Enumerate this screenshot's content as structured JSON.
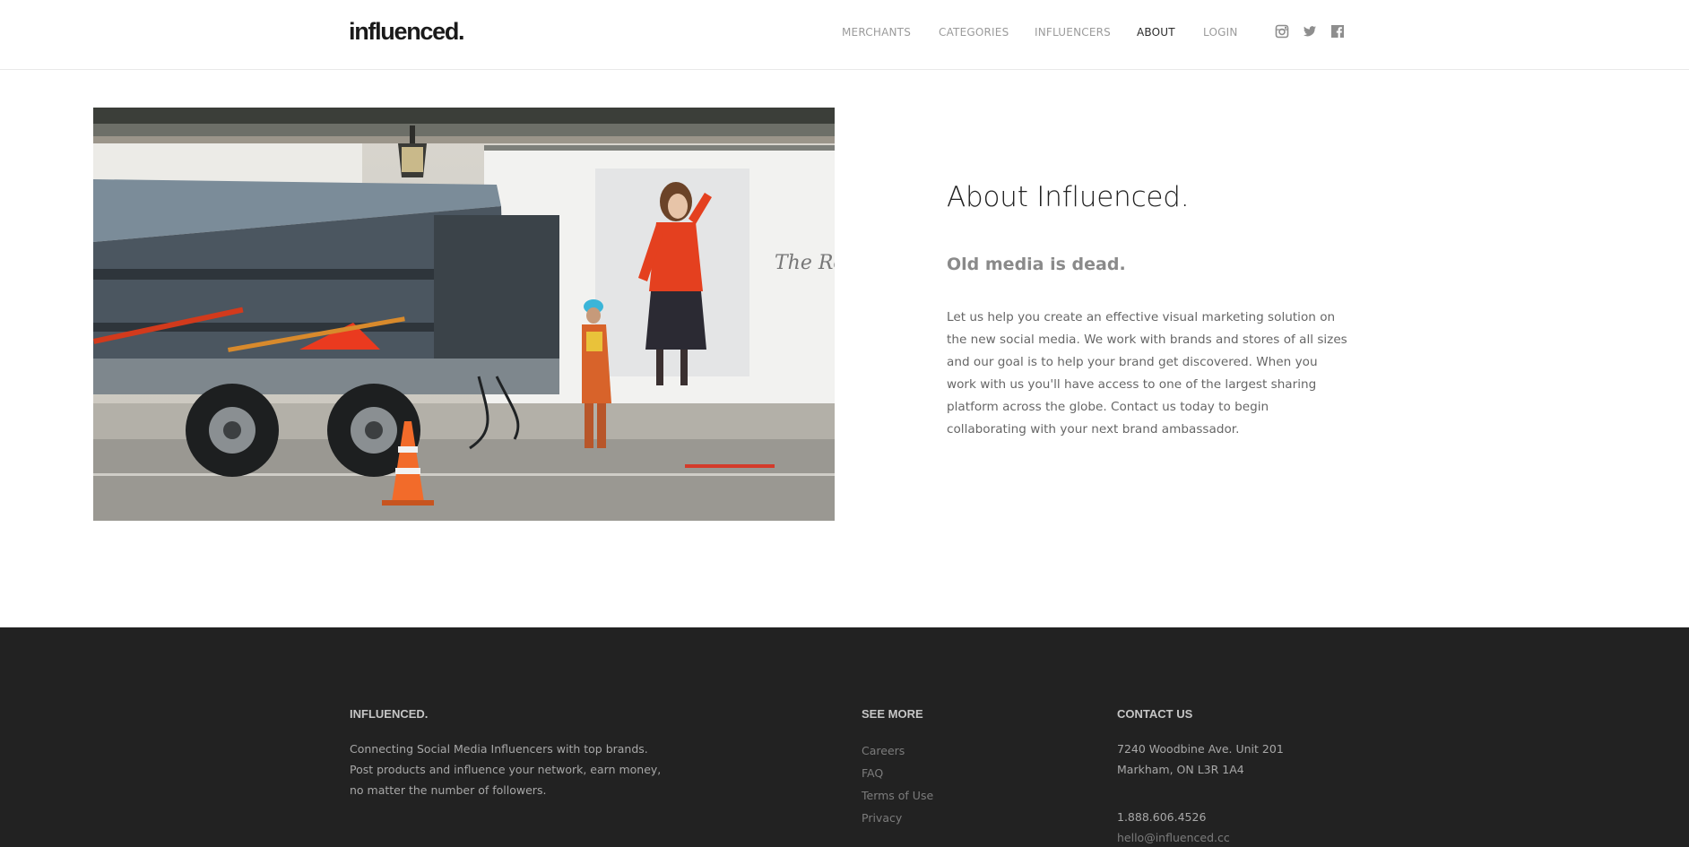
{
  "brand": {
    "logo_text": "influenced."
  },
  "nav": {
    "items": [
      {
        "label": "MERCHANTS"
      },
      {
        "label": "CATEGORIES"
      },
      {
        "label": "INFLUENCERS"
      },
      {
        "label": "ABOUT",
        "active": true
      },
      {
        "label": "LOGIN"
      }
    ],
    "social": [
      {
        "icon": "instagram-icon"
      },
      {
        "icon": "twitter-icon"
      },
      {
        "icon": "facebook-icon"
      }
    ]
  },
  "about": {
    "title": "About Influenced.",
    "subtitle": "Old media is dead.",
    "body": "Let us help you create an effective visual marketing solution on the new social media. We work with brands and stores of all sizes and our goal is to help your brand get discovered. When you work with us you'll have access to one of the largest sharing platform across the globe. Contact us today to begin collaborating with your next brand ambassador."
  },
  "footer": {
    "brand": {
      "heading": "INFLUENCED.",
      "lines": [
        "Connecting Social Media Influencers with top brands.",
        "Post products and influence your network, earn money,",
        "no matter the number of followers."
      ]
    },
    "see_more": {
      "heading": "SEE MORE",
      "links": [
        "Careers",
        "FAQ",
        "Terms of Use",
        "Privacy"
      ]
    },
    "contact": {
      "heading": "CONTACT US",
      "address_lines": [
        "7240 Woodbine Ave. Unit 201",
        "Markham, ON L3R 1A4"
      ],
      "phone": "1.888.606.4526",
      "email": "hello@influenced.cc"
    }
  },
  "colors": {
    "footer_bg": "#222222",
    "nav_active": "#2a2a2a",
    "nav_inactive": "#9b9b9b"
  }
}
